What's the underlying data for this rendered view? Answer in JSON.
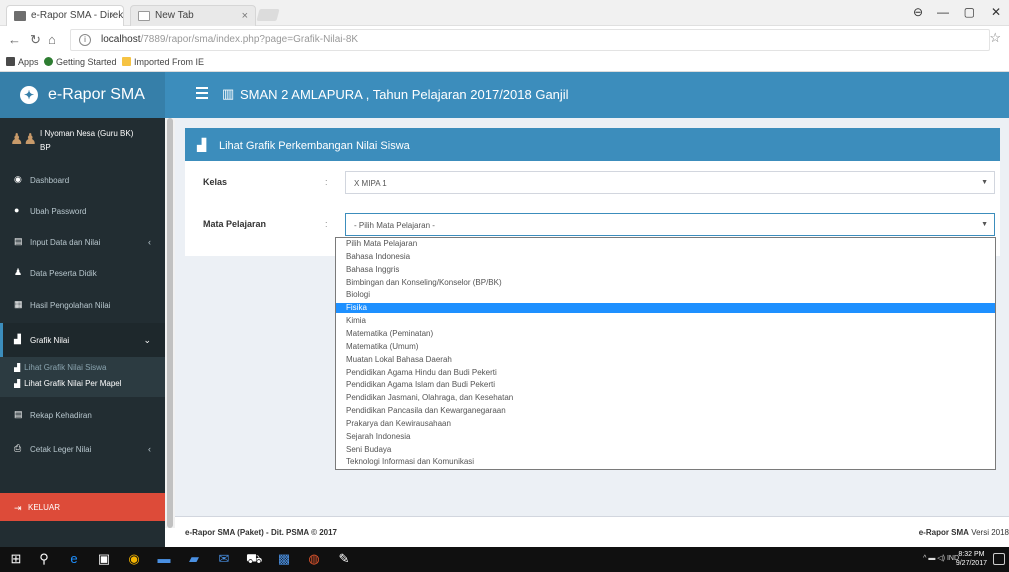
{
  "browser": {
    "tabs": [
      {
        "label": "e-Rapor SMA - Direkto...",
        "close": "×"
      },
      {
        "label": "New Tab",
        "close": "×"
      }
    ],
    "window_controls": [
      "⊖",
      "—",
      "▢",
      "✕"
    ],
    "url_host": "localhost",
    "url_path": "/7889/rapor/sma/index.php?page=Grafik-Nilai-8K",
    "bookmarks": [
      "Apps",
      "Getting Started",
      "Imported From IE"
    ]
  },
  "header": {
    "brand": "e-Rapor SMA",
    "title": "SMAN 2 AMLAPURA , Tahun Pelajaran 2017/2018 Ganjil"
  },
  "sidebar": {
    "user_name": "I Nyoman Nesa (Guru BK)",
    "user_role": "BP",
    "menu": [
      {
        "label": "Dashboard",
        "icon": "dashboard-icon",
        "glyph": "◉",
        "caret": ""
      },
      {
        "label": "Ubah Password",
        "icon": "user-icon",
        "glyph": "●",
        "caret": ""
      },
      {
        "label": "Input Data dan Nilai",
        "icon": "book-icon",
        "glyph": "▤",
        "caret": "‹"
      },
      {
        "label": "Data Peserta Didik",
        "icon": "person-icon",
        "glyph": "♟",
        "caret": ""
      },
      {
        "label": "Hasil Pengolahan Nilai",
        "icon": "table-icon",
        "glyph": "▦",
        "caret": ""
      },
      {
        "label": "Grafik Nilai",
        "icon": "bar-chart-icon",
        "glyph": "▟",
        "caret": "⌄"
      },
      {
        "label": "Rekap Kehadiran",
        "icon": "list-icon",
        "glyph": "▤",
        "caret": ""
      },
      {
        "label": "Cetak Leger Nilai",
        "icon": "print-icon",
        "glyph": "⎙",
        "caret": "‹"
      }
    ],
    "submenu": [
      {
        "label": "Lihat Grafik Nilai Siswa"
      },
      {
        "label": "Lihat Grafik Nilai Per Mapel"
      }
    ],
    "logout": "KELUAR"
  },
  "content": {
    "box_title": "Lihat Grafik Perkembangan Nilai Siswa",
    "fields": [
      {
        "label": "Kelas",
        "colon": ":",
        "value": "X MIPA 1"
      },
      {
        "label": "Mata Pelajaran",
        "colon": ":",
        "value": "- Pilih Mata Pelajaran -"
      }
    ]
  },
  "dropdown": {
    "selected_index": 5,
    "options": [
      "Pilih Mata Pelajaran",
      "Bahasa Indonesia",
      "Bahasa Inggris",
      "Bimbingan dan Konseling/Konselor (BP/BK)",
      "Biologi",
      "Fisika",
      "Kimia",
      "Matematika (Peminatan)",
      "Matematika (Umum)",
      "Muatan Lokal Bahasa Daerah",
      "Pendidikan Agama Hindu dan Budi Pekerti",
      "Pendidikan Agama Islam dan Budi Pekerti",
      "Pendidikan Jasmani, Olahraga, dan Kesehatan",
      "Pendidikan Pancasila dan Kewarganegaraan",
      "Prakarya dan Kewirausahaan",
      "Sejarah Indonesia",
      "Seni Budaya",
      "Teknologi Informasi dan Komunikasi"
    ]
  },
  "footer": {
    "left": "e-Rapor SMA (Paket) - Dit. PSMA © 2017",
    "right_bold": "e-Rapor SMA",
    "right_rest": " Versi 2018"
  },
  "taskbar": {
    "tray": "^ ▬ ◁) IND",
    "time": "8:32 PM",
    "date": "9/27/2017"
  },
  "colors": {
    "header": "#3c8dbc",
    "brand": "#367fa9",
    "sidebar": "#222d32",
    "logout": "#dd4b39",
    "selected_option": "#1e90ff"
  }
}
